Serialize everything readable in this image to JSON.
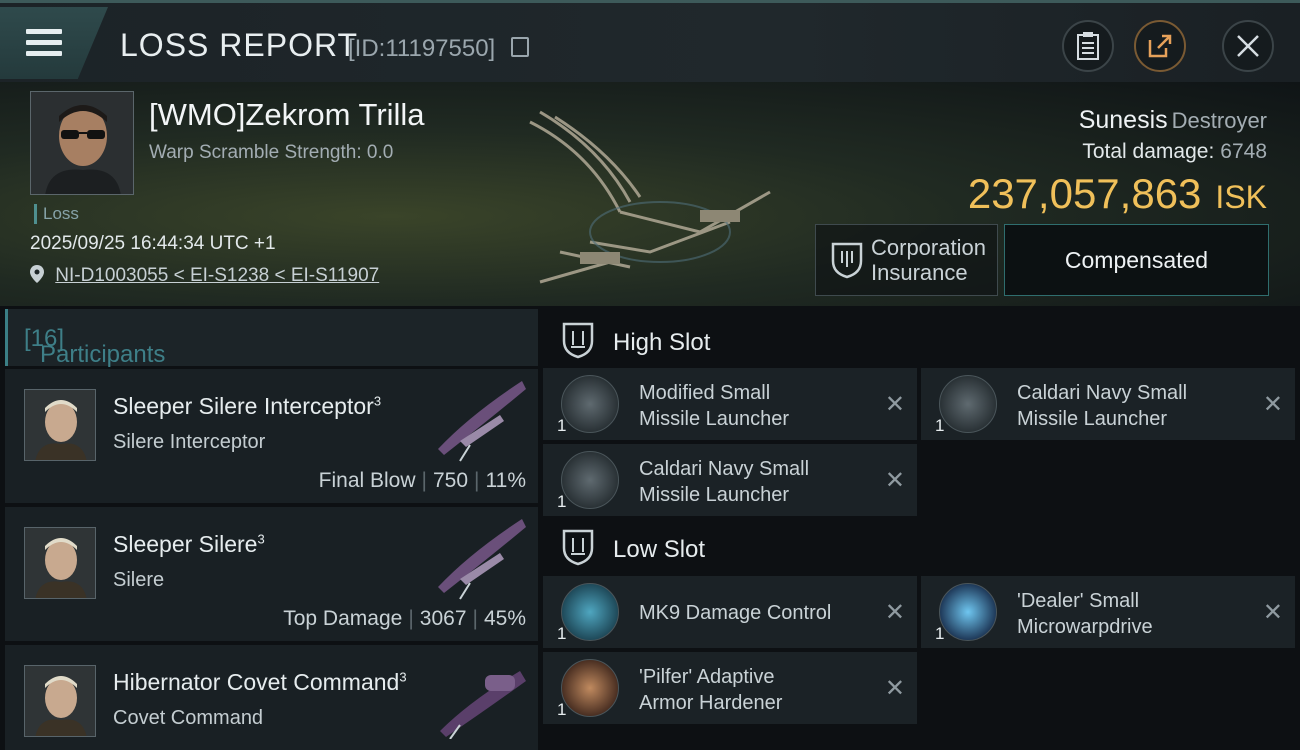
{
  "topbar": {
    "title": "LOSS REPORT",
    "report_id": "[ID:11197550]",
    "icons": [
      "menu-icon",
      "copy-icon",
      "clipboard-icon",
      "share-icon",
      "close-icon"
    ]
  },
  "header": {
    "pilot_name": "[WMO]Zekrom Trilla",
    "warp_scramble": "Warp Scramble Strength: 0.0",
    "result_tag": "Loss",
    "datetime": "2025/09/25 16:44:34 UTC +1",
    "location": "NI-D1003055 < EI-S1238 < EI-S11907",
    "ship_name": "Sunesis",
    "ship_class": "Destroyer",
    "total_damage_label": "Total damage:",
    "total_damage": "6748",
    "isk_value": "237,057,863",
    "isk_unit": "ISK",
    "insurance_label_1": "Corporation",
    "insurance_label_2": "Insurance",
    "compensation_status": "Compensated"
  },
  "participants": {
    "label": "Participants",
    "count": "[16]",
    "items": [
      {
        "name": "Sleeper Silere Interceptor",
        "tier": "3",
        "ship": "Silere Interceptor",
        "role": "Final Blow",
        "damage": "750",
        "percent": "11%"
      },
      {
        "name": "Sleeper Silere",
        "tier": "3",
        "ship": "Silere",
        "role": "Top Damage",
        "damage": "3067",
        "percent": "45%"
      },
      {
        "name": "Hibernator Covet Command",
        "tier": "3",
        "ship": "Covet Command",
        "role": "",
        "damage": "",
        "percent": ""
      }
    ]
  },
  "slots": {
    "high": {
      "title": "High Slot",
      "modules": [
        {
          "line1": "Modified Small",
          "line2": "Missile Launcher",
          "qty": "1"
        },
        {
          "line1": "Caldari Navy Small",
          "line2": "Missile Launcher",
          "qty": "1"
        },
        {
          "line1": "Caldari Navy Small",
          "line2": "Missile Launcher",
          "qty": "1"
        }
      ]
    },
    "low": {
      "title": "Low Slot",
      "modules": [
        {
          "line1": "MK9 Damage Control",
          "line2": "",
          "qty": "1"
        },
        {
          "line1": "'Dealer' Small",
          "line2": "Microwarpdrive",
          "qty": "1"
        },
        {
          "line1": "'Pilfer' Adaptive",
          "line2": "Armor Hardener",
          "qty": "1"
        }
      ]
    },
    "close_glyph": "✕"
  },
  "colors": {
    "accent_teal": "#3e7f88",
    "isk_gold": "#f0c05a",
    "panel": "#192024"
  }
}
